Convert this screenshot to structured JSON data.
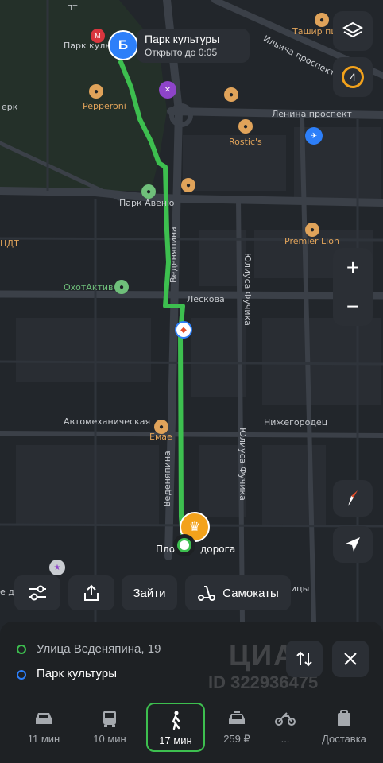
{
  "map": {
    "labels": {
      "park_au": "Парк Авеню",
      "ochotaktiv": "ОхотАктив",
      "leskova": "Лескова",
      "veden_top": "Веденяпина",
      "veden_bottom": "Веденяпина",
      "fuchika_top": "Юлиуса Фучика",
      "fuchika_bottom": "Юлиуса Фучика",
      "avtomech": "Автомеханическая",
      "emae": "Емае",
      "nizhegorodec": "Нижегородец",
      "premier": "Premier Lion",
      "rostics": "Rostic's",
      "pepperoni": "Pepperoni",
      "lenina": "Ленина проспект",
      "ilicha": "Ильича проспект",
      "tashir": "Ташир пи",
      "park_ku": "Парк культ",
      "cdt": "ЦДТ",
      "erk": "ерк",
      "pt": "пт",
      "ploshad": "Пло",
      "doroga": "дорога",
      "ni_d": "е д",
      "ncy": "ицы"
    },
    "destination": {
      "marker": "Б",
      "title": "Парк культуры",
      "hours": "Открыто до 0:05"
    },
    "layers_badge": "4",
    "colors": {
      "route": "#3dbf4f",
      "poi": "#e0a35a",
      "destination": "#2d7ff9"
    }
  },
  "controls": {
    "layers_icon": "layers-icon",
    "zoom_in": "+",
    "zoom_out": "−",
    "compass_icon": "compass-icon",
    "locate_icon": "navigation-arrow-icon"
  },
  "actions": {
    "filters_icon": "sliders-icon",
    "share_icon": "share-icon",
    "zaiti": "Зайти",
    "samokaty": "Самокаты"
  },
  "route": {
    "from": "Улица Веденяпина, 19",
    "to": "Парк культуры"
  },
  "watermark": {
    "brand": "ЦИАН",
    "id": "ID 322936475"
  },
  "modes": [
    {
      "label": "11 мин",
      "icon": "car-icon"
    },
    {
      "label": "10 мин",
      "icon": "bus-icon"
    },
    {
      "label": "17 мин",
      "icon": "pedestrian-icon"
    },
    {
      "label": "259 ₽",
      "icon": "taxi-icon"
    },
    {
      "label": "...",
      "icon": "motorcycle-icon"
    },
    {
      "label": "Доставка",
      "icon": "delivery-box-icon"
    }
  ]
}
